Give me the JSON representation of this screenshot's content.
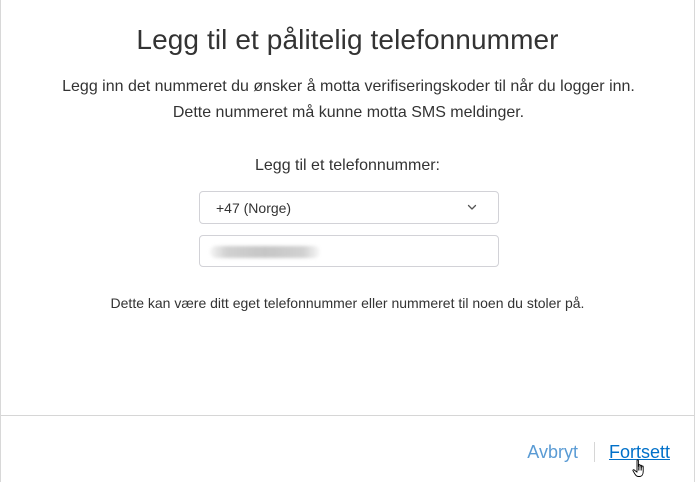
{
  "dialog": {
    "title": "Legg til et pålitelig telefonnummer",
    "description": "Legg inn det nummeret du ønsker å motta verifiseringskoder til når du logger inn. Dette nummeret må kunne motta SMS meldinger.",
    "field_label": "Legg til et telefonnummer:",
    "country_select": {
      "value": "+47 (Norge)",
      "icon": "chevron-down-icon"
    },
    "phone_input": {
      "value_state": "blurred"
    },
    "hint": "Dette kan være ditt eget telefonnummer eller nummeret til noen du stoler på."
  },
  "footer": {
    "cancel_label": "Avbryt",
    "continue_label": "Fortsett"
  },
  "colors": {
    "link": "#0070c9",
    "link_muted": "#5a9bd4",
    "text": "#333333",
    "border": "#d2d2d7"
  }
}
